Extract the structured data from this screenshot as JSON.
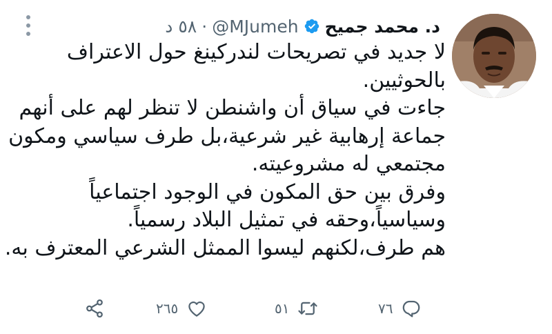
{
  "user": {
    "name": "د. محمد جميح",
    "handle": "@MJumeh",
    "separator": "·",
    "time": "٥٨ د"
  },
  "tweet": {
    "lines": [
      "لا جديد في تصريحات لندركينغ حول الاعتراف",
      "بالحوثيين.",
      "جاءت في سياق أن واشنطن لا تنظر لهم على أنهم",
      "جماعة إرهابية غير شرعية،بل طرف سياسي ومكون",
      "مجتمعي له مشروعيته.",
      "وفرق بين حق المكون في الوجود اجتماعياً",
      "وسياسياً،وحقه في تمثيل البلاد رسمياً.",
      "هم طرف،لكنهم ليسوا الممثل الشرعي المعترف به."
    ]
  },
  "actions": {
    "replies": "٧٦",
    "retweets": "٥١",
    "likes": "٢٦٥"
  },
  "icons": {
    "verified": "verified-badge-icon",
    "more": "more-options-icon",
    "reply": "reply-icon",
    "retweet": "retweet-icon",
    "like": "heart-icon",
    "share": "share-icon"
  },
  "colors": {
    "verified": "#1d9bf0",
    "icon_gray": "#536471",
    "text": "#0f1419"
  }
}
